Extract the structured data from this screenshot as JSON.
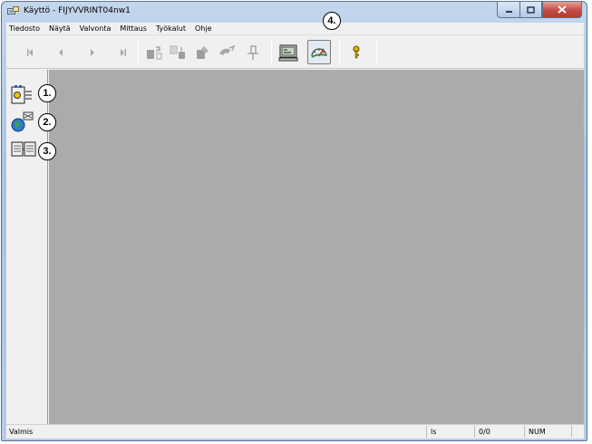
{
  "window": {
    "title": "Käyttö - FIJYVVRINT04nw1",
    "controls": [
      "minimize",
      "maximize",
      "close"
    ]
  },
  "menu": {
    "items": [
      "Tiedosto",
      "Näytä",
      "Valvonta",
      "Mittaus",
      "Työkalut",
      "Ohje"
    ]
  },
  "toolbar": {
    "buttons": [
      {
        "icon": "first-record-icon",
        "enabled": false
      },
      {
        "icon": "previous-record-icon",
        "enabled": false
      },
      {
        "icon": "next-record-icon",
        "enabled": false
      },
      {
        "icon": "last-record-icon",
        "enabled": false
      },
      {
        "icon": "upload-to-drive-icon",
        "enabled": false
      },
      {
        "icon": "download-from-drive-icon",
        "enabled": false
      },
      {
        "icon": "drive-tool-icon",
        "enabled": false
      },
      {
        "icon": "parameter-edit-icon",
        "enabled": false
      },
      {
        "icon": "pin-icon",
        "enabled": false
      },
      {
        "icon": "monitor-panel-icon",
        "enabled": true
      },
      {
        "icon": "speed-gauge-icon",
        "enabled": true,
        "pressed": true
      },
      {
        "icon": "key-icon",
        "enabled": true
      }
    ]
  },
  "sidebar": {
    "buttons": [
      {
        "icon": "drive-list-icon"
      },
      {
        "icon": "network-globe-icon"
      },
      {
        "icon": "compare-drives-icon"
      }
    ]
  },
  "callouts": [
    "1.",
    "2.",
    "3.",
    "4."
  ],
  "status": {
    "main": "Valmis",
    "panel_ls": "ls",
    "panel_count": "0/0",
    "panel_num": "NUM"
  },
  "colors": {
    "workspace": "#ababab",
    "chrome": "#f0f0f0",
    "titlebar": "#b6cbe6",
    "close_button": "#c75050"
  }
}
